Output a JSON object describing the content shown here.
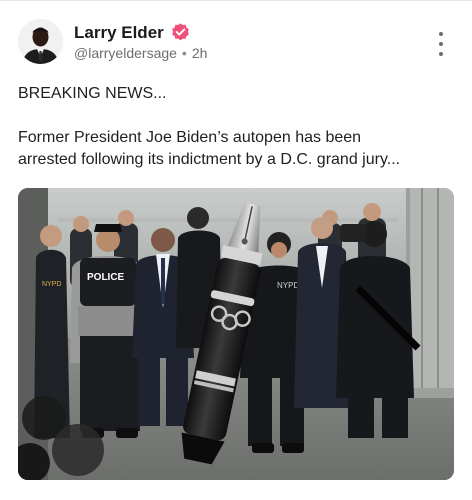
{
  "post": {
    "author_name": "Larry Elder",
    "handle": "@larryeldersage",
    "separator": "•",
    "time_ago": "2h",
    "text_line1": "BREAKING NEWS...",
    "text_line2": "Former President Joe Biden’s autopen has been",
    "text_line3": "arrested following its indictment by a D.C. grand jury...",
    "image": {
      "vest_label_center": "POLICE",
      "vest_label_right": "NYPD",
      "vest_label_left": "NYPD"
    }
  },
  "colors": {
    "verified_badge": "#f0507a",
    "muted_text": "#6e6e6e"
  },
  "icons": [
    "verified-badge-icon",
    "more-options-icon"
  ]
}
